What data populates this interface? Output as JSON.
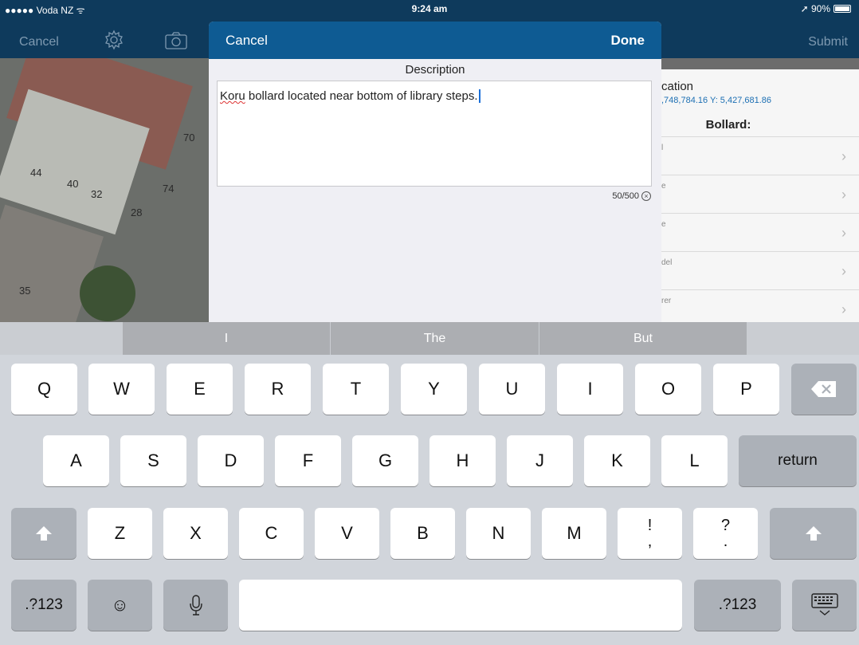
{
  "status": {
    "carrier": "●●●●● Voda NZ ᯤ",
    "time": "9:24 am",
    "battery": "➚ 90%"
  },
  "toolbar": {
    "cancel": "Cancel",
    "submit": "Submit",
    "gear_icon": "gear-icon",
    "camera_icon": "camera-icon"
  },
  "map": {
    "labels": [
      "70",
      "44",
      "40",
      "32",
      "74",
      "28",
      "35"
    ]
  },
  "details": {
    "location_title": "cation",
    "coords": ",748,784.16 Y: 5,427,681.86",
    "heading": "Bollard:",
    "rows": [
      {
        "label": "l"
      },
      {
        "label": "e"
      },
      {
        "label": "e"
      },
      {
        "label": "del"
      },
      {
        "label": "rer"
      }
    ]
  },
  "modal": {
    "cancel": "Cancel",
    "done": "Done",
    "title": "Description",
    "text_first": "Koru",
    "text_rest": " bollard located near bottom of library steps.",
    "counter": "50/500",
    "clear_icon": "⊗"
  },
  "keyboard": {
    "suggestions": [
      "I",
      "The",
      "But"
    ],
    "row1": [
      "Q",
      "W",
      "E",
      "R",
      "T",
      "Y",
      "U",
      "I",
      "O",
      "P"
    ],
    "row2": [
      "A",
      "S",
      "D",
      "F",
      "G",
      "H",
      "J",
      "K",
      "L"
    ],
    "row3": [
      "Z",
      "X",
      "C",
      "V",
      "B",
      "N",
      "M"
    ],
    "exclaim_top": "!",
    "exclaim_bottom": ",",
    "question_top": "?",
    "question_bottom": ".",
    "return": "return",
    "numbers": ".?123",
    "emoji": "☺",
    "mic": "🎙",
    "backspace": "⌫",
    "shift": "⇧",
    "hide": "⌨"
  }
}
